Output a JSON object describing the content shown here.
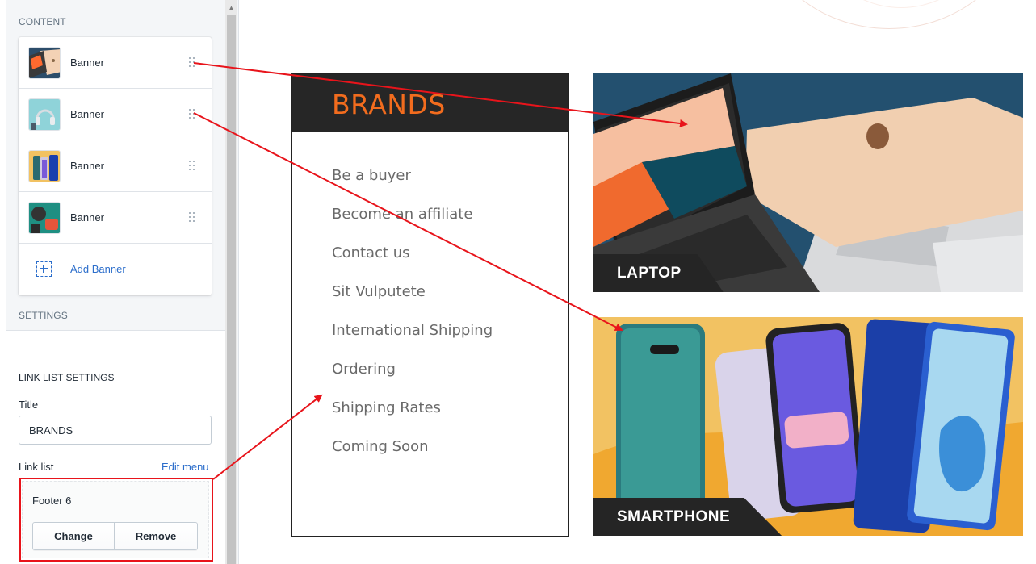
{
  "sidebar": {
    "content_label": "CONTENT",
    "banners": [
      {
        "label": "Banner",
        "thumb": "laptop"
      },
      {
        "label": "Banner",
        "thumb": "headphones"
      },
      {
        "label": "Banner",
        "thumb": "smartphone"
      },
      {
        "label": "Banner",
        "thumb": "gadgets"
      }
    ],
    "add_banner_label": "Add Banner",
    "settings_label": "SETTINGS",
    "link_list_settings_label": "LINK LIST SETTINGS",
    "title_label": "Title",
    "title_value": "BRANDS",
    "link_list_label": "Link list",
    "edit_menu_label": "Edit menu",
    "selected_menu": "Footer 6",
    "change_label": "Change",
    "remove_label": "Remove"
  },
  "preview": {
    "brands_title": "BRANDS",
    "links": [
      "Be a buyer",
      "Become an affiliate",
      "Contact us",
      "Sit Vulputete",
      "International Shipping",
      "Ordering",
      "Shipping Rates",
      "Coming Soon"
    ],
    "promo_laptop_label": "LAPTOP",
    "promo_phone_label": "SMARTPHONE"
  },
  "colors": {
    "accent_orange": "#f26c1e",
    "link_blue": "#2c6ecb",
    "annotation_red": "#e8141b",
    "header_dark": "#262626"
  }
}
